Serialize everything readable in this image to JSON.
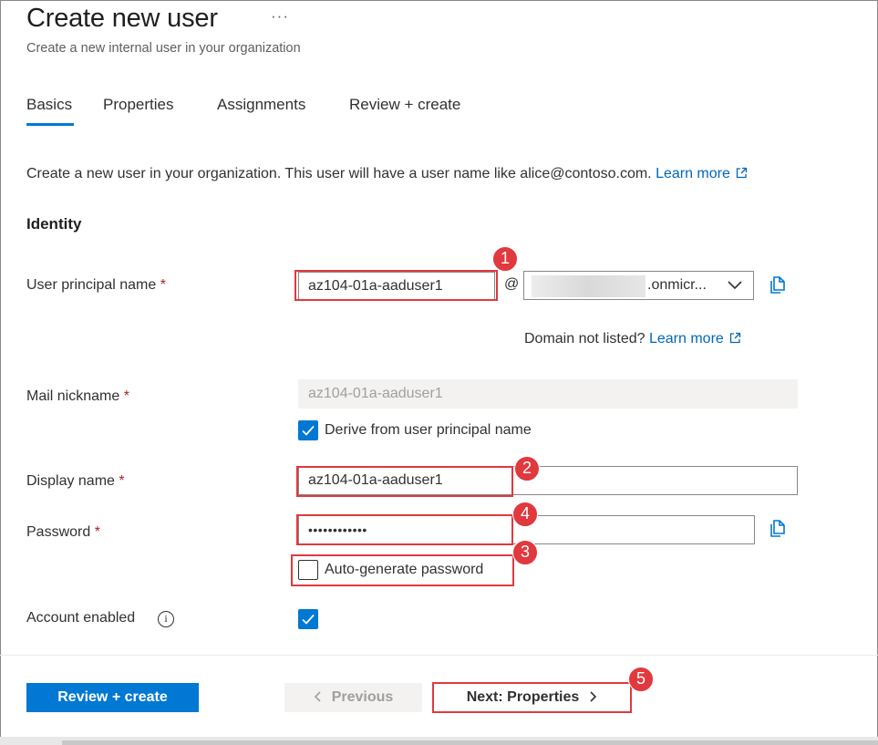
{
  "header": {
    "title": "Create new user",
    "more_label": "···",
    "subtitle": "Create a new internal user in your organization"
  },
  "tabs": [
    {
      "label": "Basics",
      "active": true
    },
    {
      "label": "Properties",
      "active": false
    },
    {
      "label": "Assignments",
      "active": false
    },
    {
      "label": "Review + create",
      "active": false
    }
  ],
  "intro": {
    "text": "Create a new user in your organization. This user will have a user name like alice@contoso.com.",
    "link": "Learn more"
  },
  "identity": {
    "section_title": "Identity",
    "upn": {
      "label": "User principal name",
      "required_mark": "*",
      "value": "az104-01a-aaduser1",
      "at_sign": "@",
      "domain_value": ".onmicr...",
      "domain_help": "Domain not listed?",
      "domain_link": "Learn more"
    },
    "mail_nickname": {
      "label": "Mail nickname",
      "required_mark": "*",
      "value": "az104-01a-aaduser1",
      "derive_label": "Derive from user principal name",
      "derive_checked": true
    },
    "display_name": {
      "label": "Display name",
      "required_mark": "*",
      "value": "az104-01a-aaduser1"
    },
    "password": {
      "label": "Password",
      "required_mark": "*",
      "value": "••••••••••••",
      "autogen_label": "Auto-generate password",
      "autogen_checked": false
    },
    "account_enabled": {
      "label": "Account enabled",
      "info_glyph": "i",
      "checked": true
    }
  },
  "annotations": [
    "1",
    "2",
    "3",
    "4",
    "5"
  ],
  "footer": {
    "review_create": "Review + create",
    "previous": "Previous",
    "next": "Next: Properties"
  },
  "colors": {
    "accent": "#0078d4",
    "link": "#0067b8",
    "required": "#a4262c",
    "annotation": "#e0393e"
  }
}
